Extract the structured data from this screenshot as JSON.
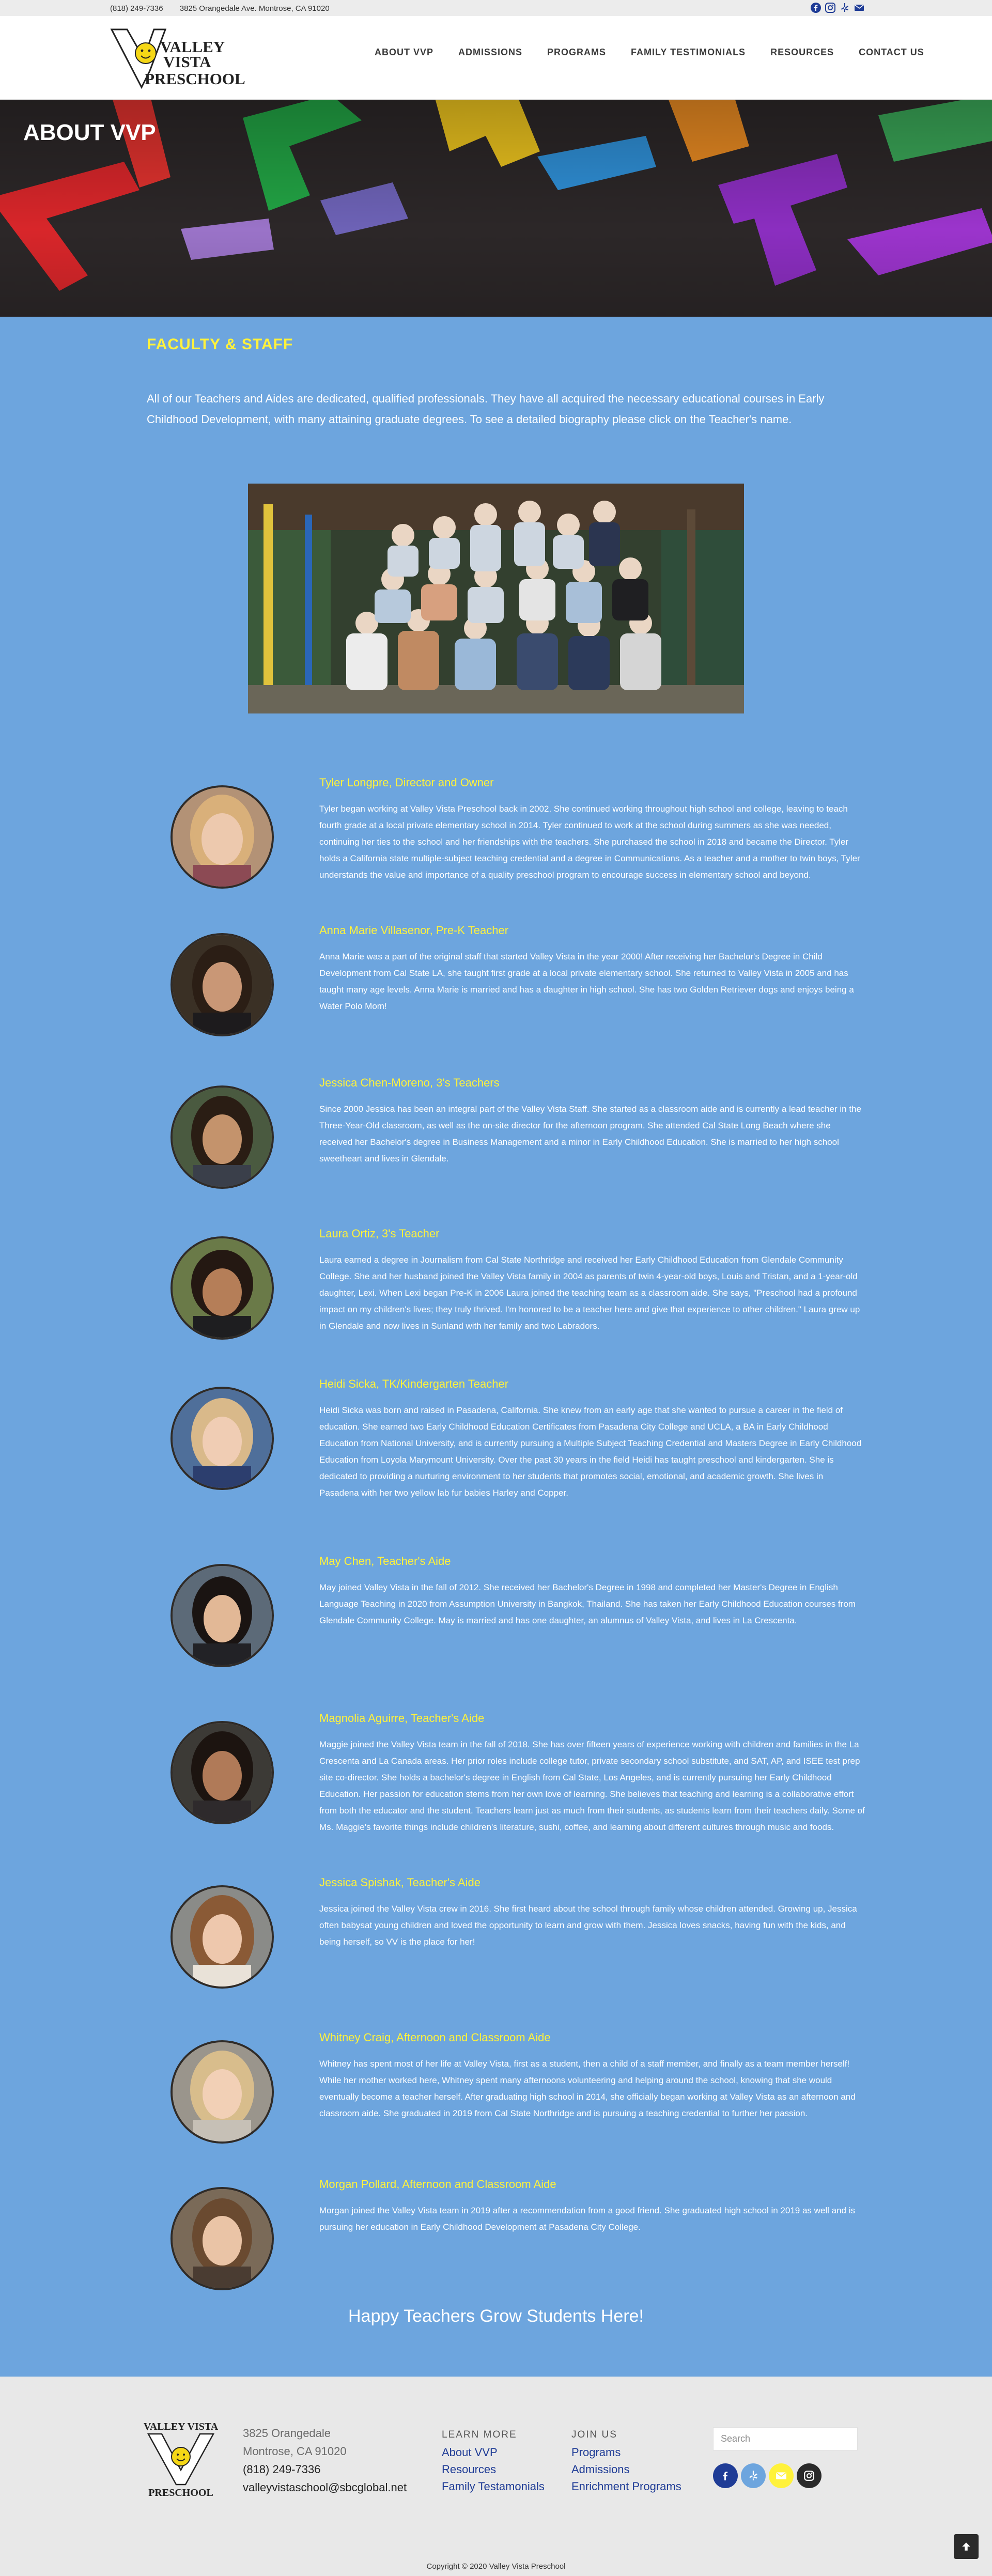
{
  "topbar": {
    "phone": "(818) 249-7336",
    "address": "3825 Orangedale Ave. Montrose, CA 91020",
    "social_icons": [
      "facebook-icon",
      "instagram-icon",
      "yelp-icon",
      "email-icon"
    ]
  },
  "header": {
    "logo_text": [
      "VALLEY",
      "VISTA",
      "PRESCHOOL"
    ],
    "nav": [
      "ABOUT VVP",
      "ADMISSIONS",
      "PROGRAMS",
      "FAMILY TESTIMONIALS",
      "RESOURCES",
      "CONTACT US"
    ]
  },
  "hero": {
    "title": "ABOUT VVP"
  },
  "main": {
    "section_title": "FACULTY & STAFF",
    "intro": "All of our Teachers and Aides are dedicated, qualified professionals.  They have all acquired the necessary educational courses in Early Childhood Development, with many attaining graduate degrees.  To see a detailed biography please click on the Teacher's name.",
    "staff": [
      {
        "name": "Tyler Longpre, Director and Owner",
        "bio": "Tyler began working at Valley Vista Preschool back in 2002. She continued working throughout high school and college, leaving to teach fourth grade at a local private elementary school in 2014. Tyler continued to work at the school during summers as she was needed, continuing her ties to the school and her friendships with the teachers. She purchased the school in 2018 and became the Director. Tyler holds a California state multiple-subject teaching credential and a degree in Communications. As a teacher and a mother to twin boys, Tyler understands the value and importance of a quality preschool program to encourage success in elementary school and beyond."
      },
      {
        "name": "Anna Marie Villasenor, Pre-K Teacher",
        "bio": "Anna Marie was a part of the original staff that started Valley Vista in the year 2000! After receiving her Bachelor's Degree in Child Development from Cal State LA, she taught first grade at a local private elementary school. She returned to Valley Vista in 2005 and has taught many age levels. Anna Marie is married and has a daughter in high school. She has two Golden Retriever dogs and enjoys being a Water Polo Mom!"
      },
      {
        "name": "Jessica Chen-Moreno, 3's Teachers",
        "bio": "Since 2000 Jessica has been an integral part of the Valley Vista Staff. She started as a classroom aide and is currently a lead teacher in the Three-Year-Old classroom, as well as the on-site director for the afternoon program. She attended Cal State Long Beach where she received her Bachelor's degree in Business Management and a minor in Early Childhood Education. She is married to her high school sweetheart and lives in Glendale."
      },
      {
        "name": "Laura Ortiz, 3's Teacher",
        "bio": "Laura earned a degree in Journalism from Cal State Northridge and received her Early Childhood Education from Glendale Community College. She and her husband joined the Valley Vista family in 2004 as parents of twin 4-year-old boys, Louis and Tristan, and a 1-year-old daughter, Lexi. When Lexi began Pre-K in 2006 Laura joined the teaching team as a classroom aide.  She says, \"Preschool had a profound impact on my children's lives; they truly thrived. I'm honored to be a teacher here and give that experience to other children.\" Laura grew up in Glendale and now lives in Sunland with her family and two Labradors."
      },
      {
        "name": "Heidi Sicka, TK/Kindergarten Teacher",
        "bio": "Heidi Sicka was born and raised in Pasadena, California.  She knew from an early age that she wanted to pursue a career in the field of education.  She earned two Early Childhood Education Certificates from Pasadena City College and UCLA, a BA in Early Childhood Education from National University, and is currently pursuing a Multiple Subject Teaching Credential and Masters Degree in Early Childhood Education from Loyola Marymount University.  Over the past  30 years in the field Heidi has taught preschool and kindergarten.  She is dedicated to providing a nurturing environment to her students that promotes social, emotional, and academic growth. She lives in Pasadena with her two yellow lab fur babies Harley and Copper."
      },
      {
        "name": "May Chen, Teacher's Aide",
        "bio": "May joined Valley Vista in the fall of 2012. She received her Bachelor's Degree in 1998 and completed her Master's Degree in English Language Teaching in 2020 from Assumption University in Bangkok, Thailand. She has taken her Early Childhood Education courses from Glendale Community College. May is married and has one daughter, an alumnus of Valley Vista, and lives in La Crescenta."
      },
      {
        "name": "Magnolia Aguirre, Teacher's Aide",
        "bio": "Maggie joined the Valley Vista team in the fall of 2018. She has over fifteen years of experience working with children and families in the La Crescenta and La Canada areas. Her prior roles include college tutor, private secondary school substitute, and SAT, AP, and ISEE test prep site co-director. She holds a bachelor's degree in English from Cal State, Los Angeles, and is currently pursuing her Early Childhood Education. Her passion for education stems from her own love of learning. She believes that teaching and learning is a collaborative effort from both the educator and the student. Teachers learn just as much from their students, as students learn from their teachers daily. Some of Ms. Maggie's favorite things include children's literature, sushi, coffee, and learning about different cultures through music and foods."
      },
      {
        "name": "Jessica Spishak, Teacher's Aide",
        "bio": "Jessica joined the Valley Vista crew in 2016. She first heard about the school through family whose children attended. Growing up, Jessica often babysat young children and loved the opportunity to learn and grow with them. Jessica loves snacks, having fun with the kids, and being herself, so VV is the place for her!"
      },
      {
        "name": "Whitney Craig, Afternoon and Classroom Aide",
        "bio": "Whitney has spent most of her life at Valley Vista, first as a student, then a child of a staff member, and finally as a team member herself! While her mother worked here, Whitney spent many afternoons volunteering and helping around the school, knowing that she would eventually become a teacher herself. After graduating high school in 2014, she officially began working at Valley Vista as an afternoon and classroom aide. She graduated in 2019 from Cal State Northridge and is pursuing a teaching credential to further her passion."
      },
      {
        "name": "Morgan Pollard, Afternoon and Classroom Aide",
        "bio": "Morgan joined the Valley Vista team in 2019 after a recommendation from a good friend. She graduated high school in 2019 as well and is pursuing her education in Early Childhood Development at Pasadena City College."
      }
    ],
    "tagline": "Happy Teachers Grow Students Here!"
  },
  "footer": {
    "logo_text": [
      "VALLEY VISTA",
      "PRESCHOOL"
    ],
    "address_line1": "3825 Orangedale",
    "address_line2": "Montrose, CA 91020",
    "phone": "(818) 249-7336",
    "email": "valleyvistaschool@sbcglobal.net",
    "learn_more": {
      "heading": "LEARN MORE",
      "links": [
        "About VVP",
        "Resources",
        "Family Testamonials"
      ]
    },
    "join_us": {
      "heading": "JOIN US",
      "links": [
        "Programs",
        "Admissions",
        "Enrichment Programs"
      ]
    },
    "search_placeholder": "Search",
    "social_icons": [
      "facebook-icon",
      "yelp-icon",
      "email-icon",
      "instagram-icon"
    ],
    "copyright": "Copyright © 2020 Valley Vista Preschool"
  },
  "colors": {
    "main_bg": "#6da5de",
    "accent_yellow": "#fff23b",
    "link_blue": "#1f3c96",
    "footer_bg": "#e8e8e8"
  }
}
